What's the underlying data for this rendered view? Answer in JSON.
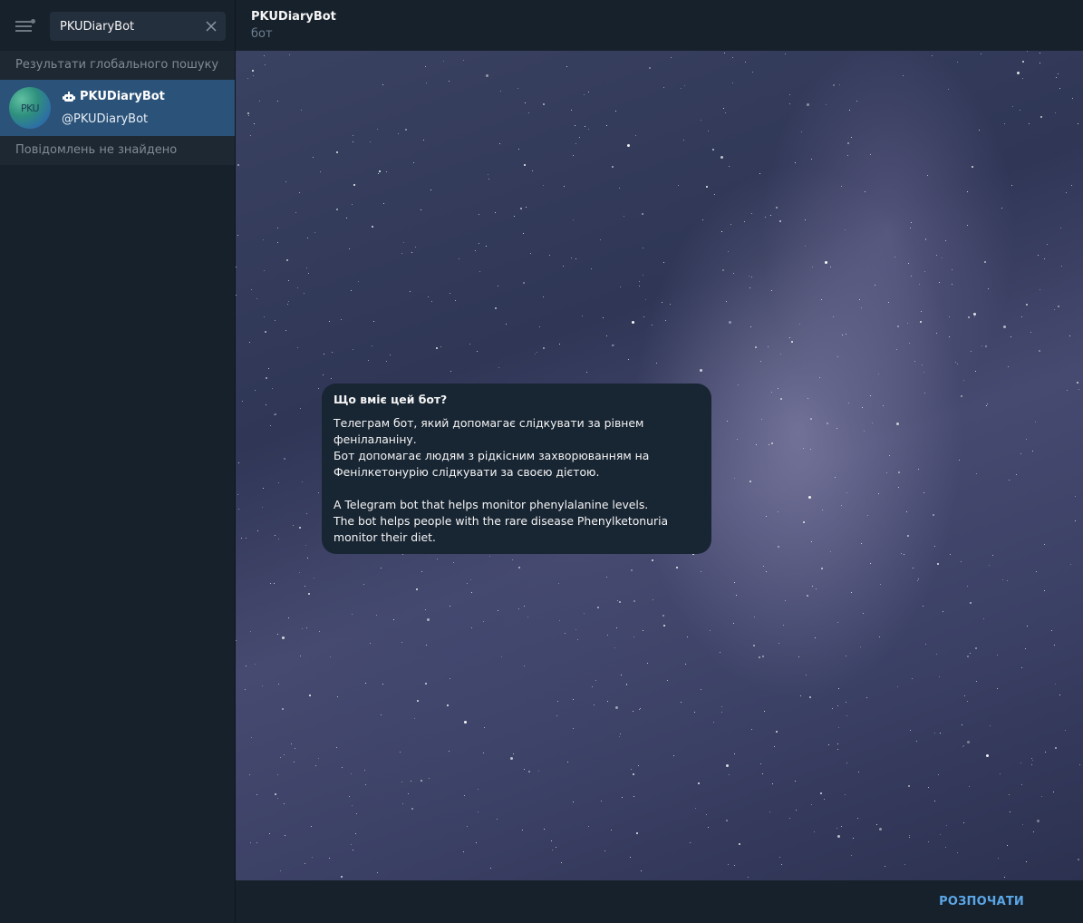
{
  "sidebar": {
    "search": {
      "value": "PKUDiaryBot",
      "placeholder": ""
    },
    "global_results_label": "Результати глобального пошуку",
    "result": {
      "avatar_text": "PKU",
      "title": "PKUDiaryBot",
      "username": "@PKUDiaryBot",
      "icon": "bot-icon"
    },
    "no_messages_label": "Повідомлень не знайдено"
  },
  "chat": {
    "title": "PKUDiaryBot",
    "status": "бот",
    "bubble": {
      "title": "Що вміє цей бот?",
      "text": "Телеграм бот, який допомагає слідкувати за рівнем фенілаланіну.\nБот допомагає людям з рідкісним захворюванням на Фенілкетонурію слідкувати за своєю дієтою.\n\nA Telegram bot that helps monitor phenylalanine levels.\nThe bot helps people with the rare disease Phenylketonuria monitor their diet."
    },
    "start_button": "РОЗПОЧАТИ"
  },
  "colors": {
    "sidebar_bg": "#17212b",
    "selected_row": "#2b5278",
    "accent": "#5aa6e6",
    "bubble_bg": "#182533"
  }
}
